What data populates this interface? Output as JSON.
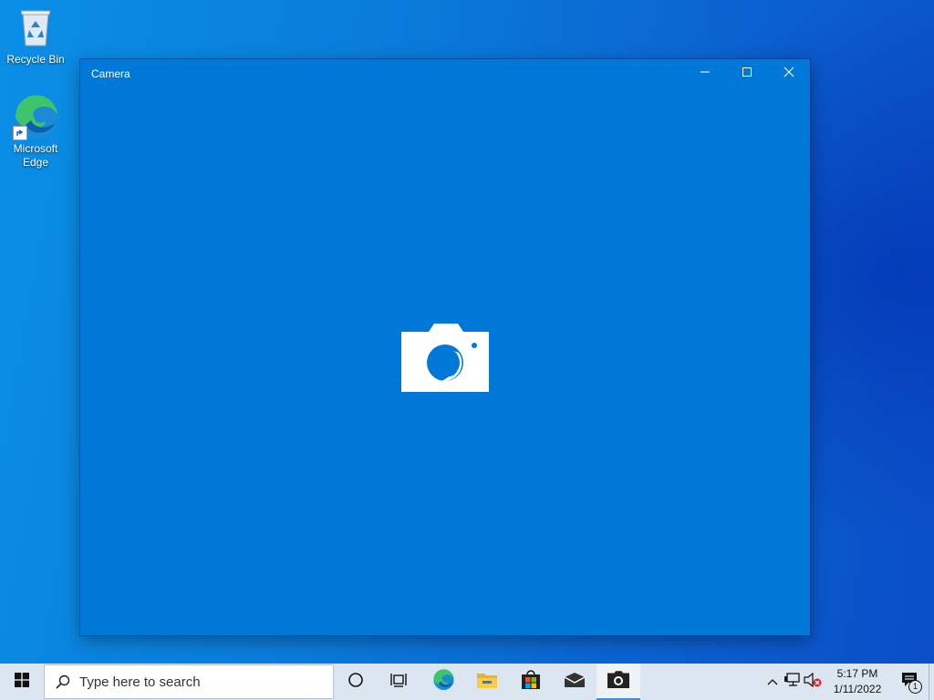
{
  "desktop": {
    "icons": [
      {
        "label": "Recycle Bin",
        "icon": "recycle-bin-icon"
      },
      {
        "label": "Microsoft Edge",
        "icon": "edge-icon"
      }
    ]
  },
  "window": {
    "title": "Camera",
    "controls": [
      "minimize-icon",
      "maximize-icon",
      "close-icon"
    ],
    "center_icon": "camera-icon",
    "background_color": "#0078d7"
  },
  "taskbar": {
    "search_placeholder": "Type here to search",
    "pinned": [
      "cortana-icon",
      "task-view-icon",
      "edge-icon",
      "file-explorer-icon",
      "store-icon",
      "mail-icon",
      "camera-icon"
    ],
    "active_app": "Camera",
    "clock": {
      "time": "5:17 PM",
      "date": "1/11/2022"
    },
    "notification_count": "1"
  }
}
